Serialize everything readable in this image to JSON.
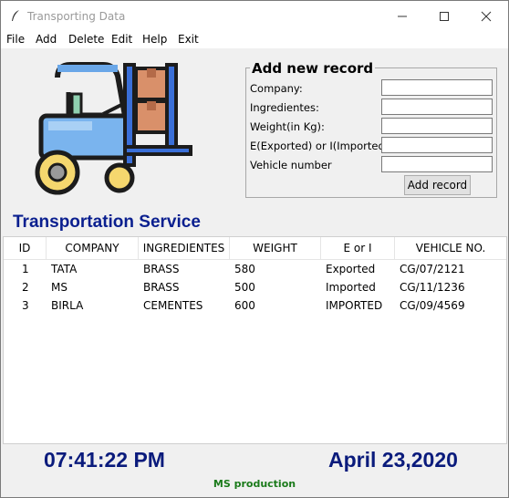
{
  "window": {
    "title": "Transporting Data"
  },
  "menu": [
    "File",
    "Add",
    "Delete",
    "Edit",
    "Help",
    "Exit"
  ],
  "form": {
    "title": "Add new record",
    "fields": [
      {
        "label": "Company:",
        "value": ""
      },
      {
        "label": "Ingredientes:",
        "value": ""
      },
      {
        "label": "Weight(in Kg):",
        "value": ""
      },
      {
        "label": "E(Exported) or I(Imported):",
        "value": ""
      },
      {
        "label": "Vehicle number",
        "value": ""
      }
    ],
    "button": "Add record"
  },
  "heading": "Transportation Service",
  "table": {
    "columns": [
      "ID",
      "COMPANY",
      "INGREDIENTES",
      "WEIGHT",
      "E or I",
      "VEHICLE NO."
    ],
    "rows": [
      [
        "1",
        "TATA",
        "BRASS",
        "580",
        "Exported",
        "CG/07/2121"
      ],
      [
        "2",
        "MS",
        "BRASS",
        "500",
        "Imported",
        "CG/11/1236"
      ],
      [
        "3",
        "BIRLA",
        "CEMENTES",
        "600",
        "IMPORTED",
        "CG/09/4569"
      ]
    ]
  },
  "footer": {
    "time": "07:41:22 PM",
    "date": "April 23,2020",
    "credit": "MS production"
  },
  "icons": {
    "app": "feather-icon",
    "logo": "forklift-icon"
  }
}
